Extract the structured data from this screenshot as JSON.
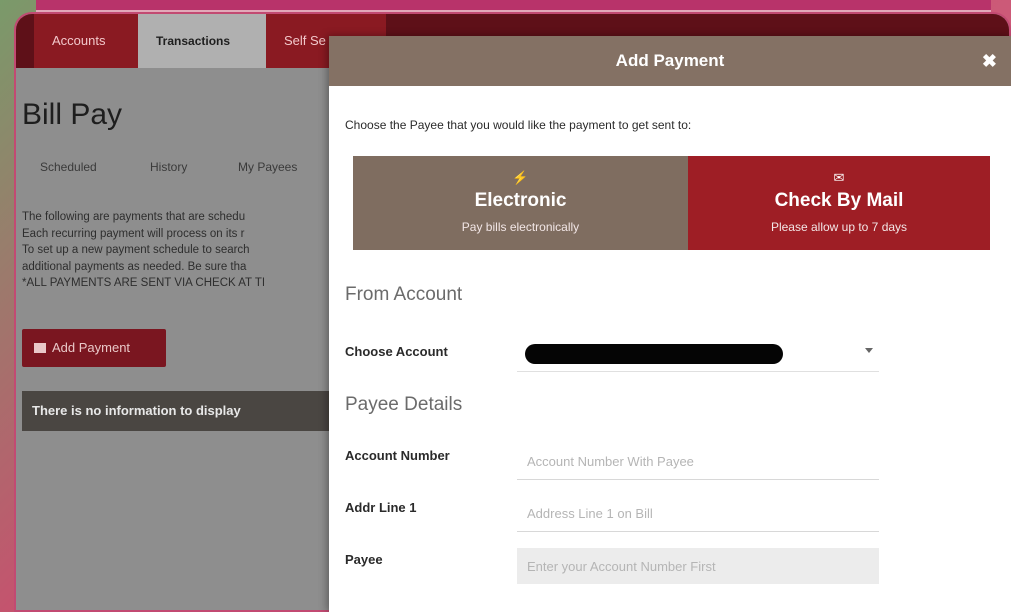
{
  "nav": {
    "tabs": [
      {
        "label": "Accounts"
      },
      {
        "label": "Transactions"
      },
      {
        "label": "Self Se"
      }
    ]
  },
  "page": {
    "title": "Bill Pay",
    "sub_tabs": [
      "Scheduled",
      "History",
      "My Payees"
    ],
    "description_lines": [
      "The following are payments that are schedu",
      "Each recurring payment will process on its r",
      "To set up a new payment schedule to search",
      "additional payments as needed. Be sure tha",
      "*ALL PAYMENTS ARE SENT VIA CHECK AT TI"
    ],
    "add_payment_label": "Add Payment",
    "no_info_text": "There is no information to display"
  },
  "modal": {
    "title": "Add Payment",
    "close_glyph": "✖",
    "choose_text": "Choose the Payee that you would like the payment to get sent to:",
    "options": [
      {
        "icon": "⚡",
        "title": "Electronic",
        "subtitle": "Pay bills electronically"
      },
      {
        "icon": "✉",
        "title": "Check By Mail",
        "subtitle": "Please allow up to 7 days"
      }
    ],
    "from_account_heading": "From Account",
    "choose_account_label": "Choose Account",
    "payee_details_heading": "Payee Details",
    "fields": [
      {
        "label": "Account Number",
        "placeholder": "Account Number With Payee"
      },
      {
        "label": "Addr Line 1",
        "placeholder": "Address Line 1 on Bill"
      },
      {
        "label": "Payee",
        "placeholder": "Enter your Account Number First"
      }
    ]
  },
  "colors": {
    "nav_bg": "#5e1018",
    "modal_header": "#847164",
    "electronic_bg": "#7f6d60",
    "mail_bg": "#9e1e25",
    "add_payment_bg": "#7a1620"
  }
}
